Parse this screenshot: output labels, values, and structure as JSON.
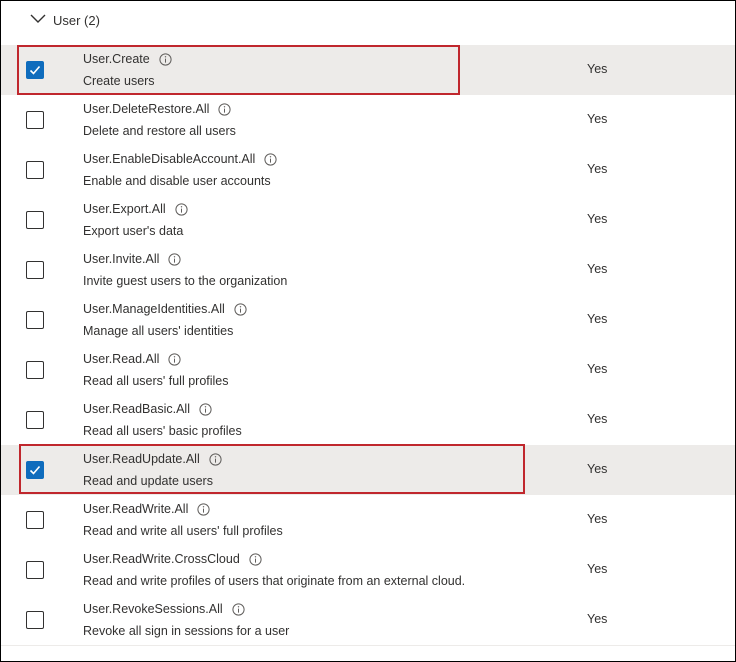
{
  "group": {
    "label": "User (2)",
    "icon": "chevron-down-icon"
  },
  "permissions": [
    {
      "name": "User.Create",
      "description": "Create users",
      "admin_consent": "Yes",
      "checked": true
    },
    {
      "name": "User.DeleteRestore.All",
      "description": "Delete and restore all users",
      "admin_consent": "Yes",
      "checked": false
    },
    {
      "name": "User.EnableDisableAccount.All",
      "description": "Enable and disable user accounts",
      "admin_consent": "Yes",
      "checked": false
    },
    {
      "name": "User.Export.All",
      "description": "Export user's data",
      "admin_consent": "Yes",
      "checked": false
    },
    {
      "name": "User.Invite.All",
      "description": "Invite guest users to the organization",
      "admin_consent": "Yes",
      "checked": false
    },
    {
      "name": "User.ManageIdentities.All",
      "description": "Manage all users' identities",
      "admin_consent": "Yes",
      "checked": false
    },
    {
      "name": "User.Read.All",
      "description": "Read all users' full profiles",
      "admin_consent": "Yes",
      "checked": false
    },
    {
      "name": "User.ReadBasic.All",
      "description": "Read all users' basic profiles",
      "admin_consent": "Yes",
      "checked": false
    },
    {
      "name": "User.ReadUpdate.All",
      "description": "Read and update users",
      "admin_consent": "Yes",
      "checked": true
    },
    {
      "name": "User.ReadWrite.All",
      "description": "Read and write all users' full profiles",
      "admin_consent": "Yes",
      "checked": false
    },
    {
      "name": "User.ReadWrite.CrossCloud",
      "description": "Read and write profiles of users that originate from an external cloud.",
      "admin_consent": "Yes",
      "checked": false
    },
    {
      "name": "User.RevokeSessions.All",
      "description": "Revoke all sign in sessions for a user",
      "admin_consent": "Yes",
      "checked": false
    }
  ],
  "colors": {
    "checked": "#0f6cbd",
    "selected_row": "#edebe9",
    "highlight": "#c0272d"
  },
  "icons": {
    "info": "info-icon",
    "check": "checkmark-icon"
  }
}
